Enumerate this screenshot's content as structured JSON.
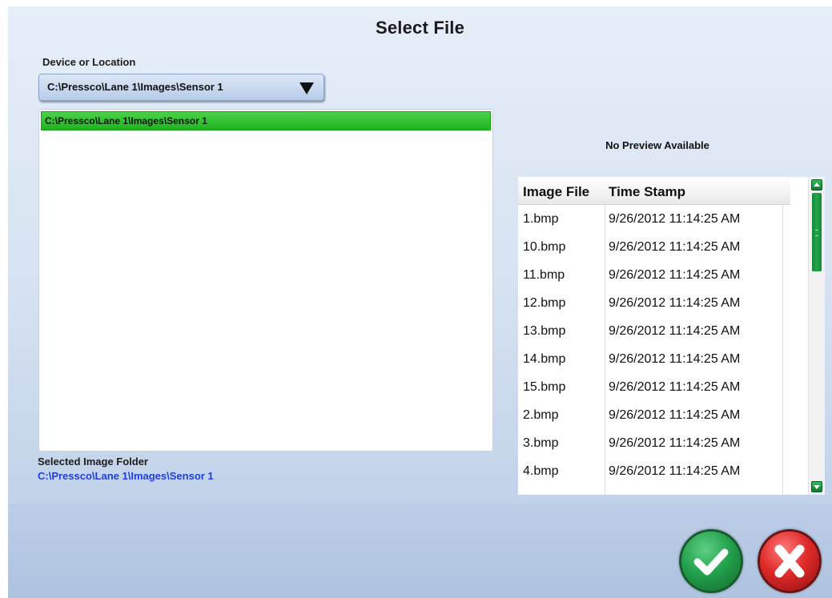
{
  "dialog": {
    "title": "Select File"
  },
  "location": {
    "label": "Device or Location",
    "selected": "C:\\Pressco\\Lane 1\\Images\\Sensor 1"
  },
  "folder_tree": {
    "items": [
      {
        "label": "C:\\Pressco\\Lane 1\\Images\\Sensor 1",
        "selected": true
      }
    ]
  },
  "selected_folder": {
    "label": "Selected Image Folder",
    "path": "C:\\Pressco\\Lane 1\\Images\\Sensor 1"
  },
  "preview": {
    "text": "No Preview Available"
  },
  "file_table": {
    "headers": {
      "file": "Image File",
      "time": "Time Stamp"
    },
    "rows": [
      {
        "file": "1.bmp",
        "time": "9/26/2012 11:14:25 AM"
      },
      {
        "file": "10.bmp",
        "time": "9/26/2012 11:14:25 AM"
      },
      {
        "file": "11.bmp",
        "time": "9/26/2012 11:14:25 AM"
      },
      {
        "file": "12.bmp",
        "time": "9/26/2012 11:14:25 AM"
      },
      {
        "file": "13.bmp",
        "time": "9/26/2012 11:14:25 AM"
      },
      {
        "file": "14.bmp",
        "time": "9/26/2012 11:14:25 AM"
      },
      {
        "file": "15.bmp",
        "time": "9/26/2012 11:14:25 AM"
      },
      {
        "file": "2.bmp",
        "time": "9/26/2012 11:14:25 AM"
      },
      {
        "file": "3.bmp",
        "time": "9/26/2012 11:14:25 AM"
      },
      {
        "file": "4.bmp",
        "time": "9/26/2012 11:14:25 AM"
      }
    ]
  },
  "actions": {
    "ok_icon": "checkmark-icon",
    "cancel_icon": "x-icon",
    "ok_color": "#23a24c",
    "cancel_color": "#e02a2a"
  }
}
